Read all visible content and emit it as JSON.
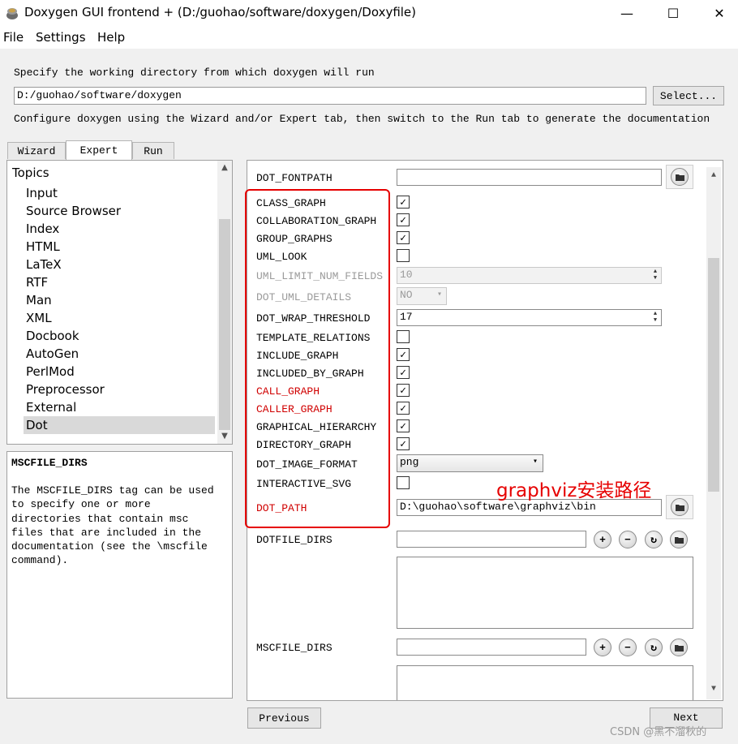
{
  "window": {
    "title": "Doxygen GUI frontend + (D:/guohao/software/doxygen/Doxyfile)",
    "minimize_glyph": "—",
    "maximize_glyph": "☐",
    "close_glyph": "✕"
  },
  "menu": {
    "file": "File",
    "settings": "Settings",
    "help": "Help"
  },
  "workdir": {
    "label": "Specify the working directory from which doxygen will run",
    "value": "D:/guohao/software/doxygen",
    "select_button": "Select...",
    "configure_hint": "Configure doxygen using the Wizard and/or Expert tab, then switch to the Run tab to generate the documentation"
  },
  "tabs": {
    "wizard": "Wizard",
    "expert": "Expert",
    "run": "Run",
    "active": "Expert"
  },
  "topics": {
    "title": "Topics",
    "items": [
      "Input",
      "Source Browser",
      "Index",
      "HTML",
      "LaTeX",
      "RTF",
      "Man",
      "XML",
      "Docbook",
      "AutoGen",
      "PerlMod",
      "Preprocessor",
      "External",
      "Dot"
    ],
    "selected": "Dot"
  },
  "help": {
    "title": "MSCFILE_DIRS",
    "body": "The MSCFILE_DIRS tag can be used\nto specify one or more\ndirectories that contain msc\nfiles that are included in the\ndocumentation (see the \\mscfile\ncommand)."
  },
  "options": {
    "dot_fontpath": {
      "label": "DOT_FONTPATH",
      "value": ""
    },
    "class_graph": {
      "label": "CLASS_GRAPH",
      "checked": true
    },
    "collaboration_graph": {
      "label": "COLLABORATION_GRAPH",
      "checked": true
    },
    "group_graphs": {
      "label": "GROUP_GRAPHS",
      "checked": true
    },
    "uml_look": {
      "label": "UML_LOOK",
      "checked": false
    },
    "uml_limit_num_fields": {
      "label": "UML_LIMIT_NUM_FIELDS",
      "value": "10"
    },
    "dot_uml_details": {
      "label": "DOT_UML_DETAILS",
      "value": "NO"
    },
    "dot_wrap_threshold": {
      "label": "DOT_WRAP_THRESHOLD",
      "value": "17"
    },
    "template_relations": {
      "label": "TEMPLATE_RELATIONS",
      "checked": false
    },
    "include_graph": {
      "label": "INCLUDE_GRAPH",
      "checked": true
    },
    "included_by_graph": {
      "label": "INCLUDED_BY_GRAPH",
      "checked": true
    },
    "call_graph": {
      "label": "CALL_GRAPH",
      "checked": true
    },
    "caller_graph": {
      "label": "CALLER_GRAPH",
      "checked": true
    },
    "graphical_hierarchy": {
      "label": "GRAPHICAL_HIERARCHY",
      "checked": true
    },
    "directory_graph": {
      "label": "DIRECTORY_GRAPH",
      "checked": true
    },
    "dot_image_format": {
      "label": "DOT_IMAGE_FORMAT",
      "value": "png"
    },
    "interactive_svg": {
      "label": "INTERACTIVE_SVG",
      "checked": false
    },
    "dot_path": {
      "label": "DOT_PATH",
      "value": "D:\\guohao\\software\\graphviz\\bin"
    },
    "dotfile_dirs": {
      "label": "DOTFILE_DIRS",
      "value": ""
    },
    "mscfile_dirs": {
      "label": "MSCFILE_DIRS",
      "value": ""
    }
  },
  "glyphs": {
    "check": "✓",
    "plus": "+",
    "minus": "−",
    "refresh": "↻",
    "dropdown": "▾",
    "up": "▲",
    "down": "▼"
  },
  "navigation": {
    "previous": "Previous",
    "next": "Next"
  },
  "annotation": "graphviz安装路径",
  "watermark": "CSDN @黑不溜秋的",
  "colors": {
    "highlight_red": "#e60000",
    "label_red": "#d00000"
  }
}
